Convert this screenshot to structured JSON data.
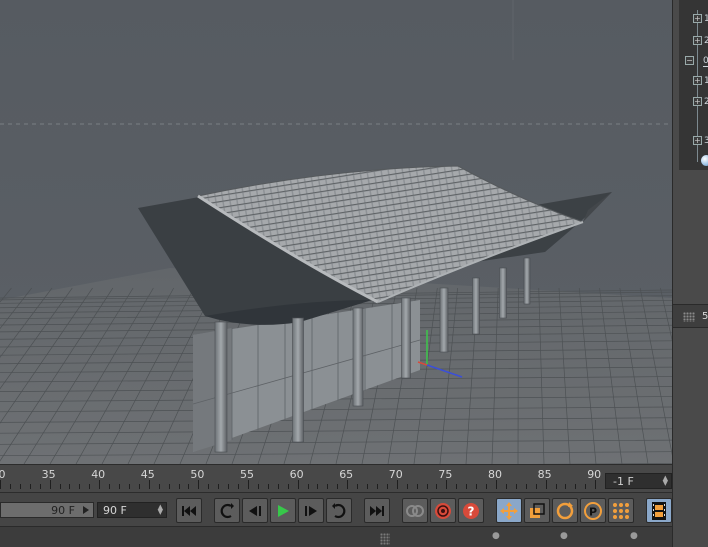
{
  "timeline": {
    "ticks": [
      "0",
      "35",
      "40",
      "45",
      "50",
      "55",
      "60",
      "65",
      "70",
      "75",
      "80",
      "85",
      "90"
    ],
    "current_frame": "-1 F"
  },
  "transport": {
    "max_frame": "90 F",
    "end_frame": "90 F"
  },
  "object_tree": {
    "items": [
      "1",
      "2",
      "0",
      "1",
      "2",
      "3"
    ]
  },
  "attributes": {
    "number": "5"
  },
  "colors": {
    "viewport_bg": "#555a60",
    "play_green": "#37c84a",
    "record_red": "#d84a3a",
    "tool_orange": "#f29f3c",
    "active_blue": "#8aa7c9"
  },
  "icons": {
    "first_frame": "skip-to-start-icon",
    "prev_key": "prev-key-icon",
    "prev_frame": "step-back-icon",
    "play": "play-icon",
    "next_frame": "step-forward-icon",
    "next_key": "next-key-icon",
    "last_frame": "skip-to-end-icon",
    "record": "record-keys-icon",
    "autokey": "autokey-icon",
    "help": "question-icon",
    "move": "move-icon",
    "scale": "scale-icon",
    "rotate": "rotate-icon",
    "param": "parameter-icon",
    "grid": "point-grid-icon",
    "film": "film-icon"
  }
}
